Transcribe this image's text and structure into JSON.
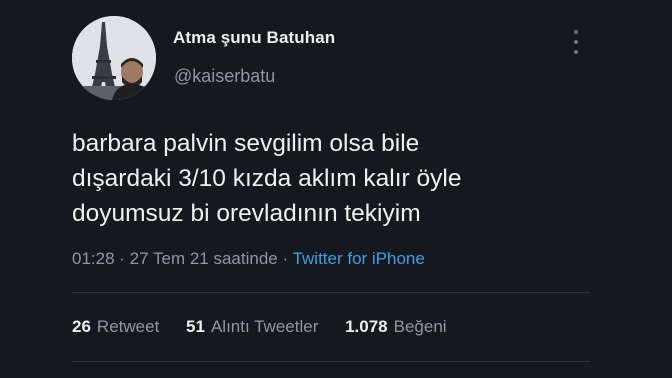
{
  "tweet": {
    "display_name": "Atma şunu Batuhan",
    "username": "@kaiserbatu",
    "text_lines": [
      "barbara palvin sevgilim olsa bile",
      "dışardaki 3/10 kızda aklım kalır öyle",
      "doyumsuz bi orevladının tekiyim"
    ],
    "time": "01:28",
    "separator": "·",
    "date": "27 Tem 21 saatinde",
    "source": "Twitter for iPhone"
  },
  "stats": {
    "retweets_count": "26",
    "retweets_label": "Retweet",
    "quotes_count": "51",
    "quotes_label": "Alıntı Tweetler",
    "likes_count": "1.078",
    "likes_label": "Beğeni"
  },
  "icons": {
    "more": "more-vertical-icon"
  },
  "colors": {
    "background": "#15181d",
    "link": "#3e9ee8",
    "secondary_text": "#8b98a5"
  }
}
